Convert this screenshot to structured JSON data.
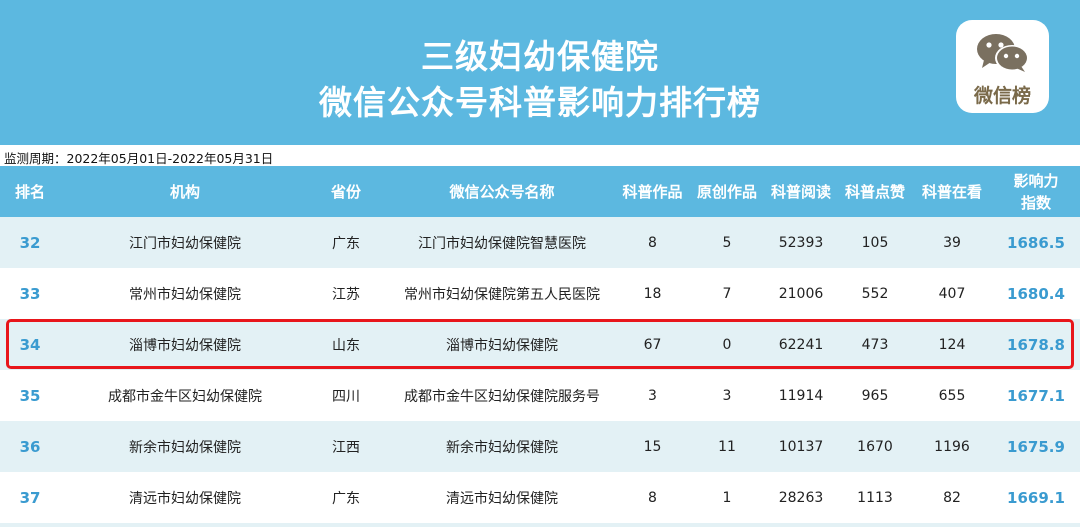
{
  "header": {
    "title_line1": "三级妇幼保健院",
    "title_line2": "微信公众号科普影响力排行榜",
    "badge_label": "微信榜",
    "badge_icon": "wechat-icon",
    "background_color": "#5cb8e0"
  },
  "period": "监测周期：2022年05月01日-2022年05月31日",
  "table": {
    "columns": [
      {
        "label": "排名"
      },
      {
        "label": "机构"
      },
      {
        "label": "省份"
      },
      {
        "label": "微信公众号名称"
      },
      {
        "label": "科普作品"
      },
      {
        "label": "原创作品"
      },
      {
        "label": "科普阅读"
      },
      {
        "label": "科普点赞"
      },
      {
        "label": "科普在看"
      },
      {
        "label_line1": "影响力",
        "label_line2": "指数"
      }
    ],
    "rows": [
      {
        "rank": "32",
        "org": "江门市妇幼保健院",
        "province": "广东",
        "account": "江门市妇幼保健院智慧医院",
        "works": "8",
        "original": "5",
        "reads": "52393",
        "likes": "105",
        "watching": "39",
        "index": "1686.5"
      },
      {
        "rank": "33",
        "org": "常州市妇幼保健院",
        "province": "江苏",
        "account": "常州市妇幼保健院第五人民医院",
        "works": "18",
        "original": "7",
        "reads": "21006",
        "likes": "552",
        "watching": "407",
        "index": "1680.4"
      },
      {
        "rank": "34",
        "org": "淄博市妇幼保健院",
        "province": "山东",
        "account": "淄博市妇幼保健院",
        "works": "67",
        "original": "0",
        "reads": "62241",
        "likes": "473",
        "watching": "124",
        "index": "1678.8"
      },
      {
        "rank": "35",
        "org": "成都市金牛区妇幼保健院",
        "province": "四川",
        "account": "成都市金牛区妇幼保健院服务号",
        "works": "3",
        "original": "3",
        "reads": "11914",
        "likes": "965",
        "watching": "655",
        "index": "1677.1"
      },
      {
        "rank": "36",
        "org": "新余市妇幼保健院",
        "province": "江西",
        "account": "新余市妇幼保健院",
        "works": "15",
        "original": "11",
        "reads": "10137",
        "likes": "1670",
        "watching": "1196",
        "index": "1675.9"
      },
      {
        "rank": "37",
        "org": "清远市妇幼保健院",
        "province": "广东",
        "account": "清远市妇幼保健院",
        "works": "8",
        "original": "1",
        "reads": "28263",
        "likes": "1113",
        "watching": "82",
        "index": "1669.1"
      }
    ],
    "highlight_color": "#e8161b",
    "accent_color": "#3a9bd0"
  }
}
